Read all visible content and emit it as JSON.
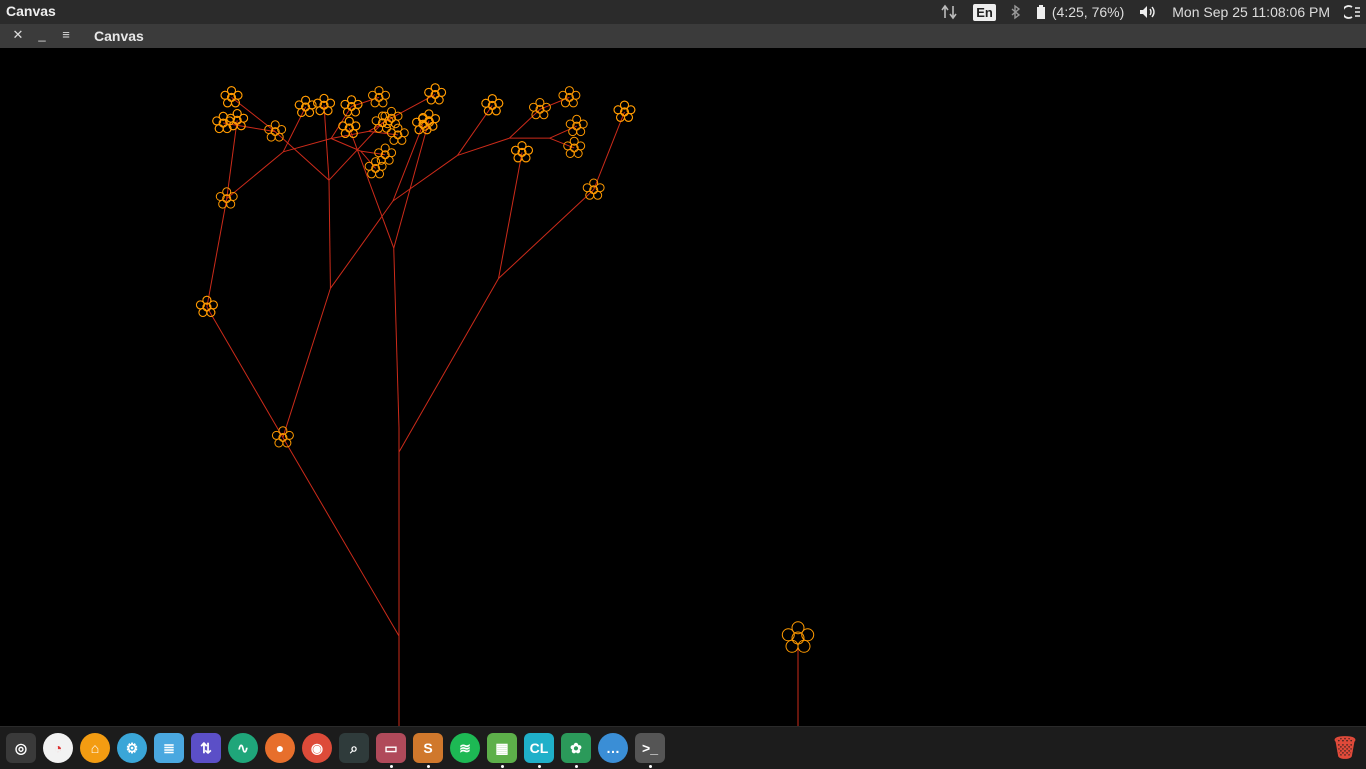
{
  "topbar": {
    "app_title": "Canvas",
    "keyboard_layout": "En",
    "battery_status": "(4:25, 76%)",
    "datetime": "Mon Sep 25 11:08:06 PM"
  },
  "window": {
    "title": "Canvas",
    "close_glyph": "✕",
    "minimize_glyph": "_",
    "menu_glyph": "≡"
  },
  "canvas": {
    "background": "#000000",
    "branch_color": "#cc2b1a",
    "flower_color": "#ff9a00"
  },
  "dock": {
    "items": [
      {
        "name": "launcher-icon",
        "color": "#3a3a3a",
        "glyph": "◎"
      },
      {
        "name": "disk-usage-icon",
        "color": "#f2f2f2",
        "glyph": "◔"
      },
      {
        "name": "ubuntu-software-icon",
        "color": "#f39c12",
        "glyph": "⌂"
      },
      {
        "name": "settings-icon",
        "color": "#3aa6d8",
        "glyph": "⚙"
      },
      {
        "name": "text-editor-icon",
        "color": "#4aa8e0",
        "glyph": "≣"
      },
      {
        "name": "network-icon",
        "color": "#5b4fc7",
        "glyph": "⇅"
      },
      {
        "name": "system-monitor-icon",
        "color": "#1fa67a",
        "glyph": "∿"
      },
      {
        "name": "firefox-icon",
        "color": "#e76f2c",
        "glyph": "●"
      },
      {
        "name": "chrome-icon",
        "color": "#dd4b39",
        "glyph": "◉"
      },
      {
        "name": "screenshot-icon",
        "color": "#2f3b3b",
        "glyph": "⌕"
      },
      {
        "name": "files-icon",
        "color": "#b04a5a",
        "glyph": "▭"
      },
      {
        "name": "sublime-text-icon",
        "color": "#d0782c",
        "glyph": "S"
      },
      {
        "name": "spotify-icon",
        "color": "#1db954",
        "glyph": "≋"
      },
      {
        "name": "image-viewer-icon",
        "color": "#5db04a",
        "glyph": "▦"
      },
      {
        "name": "clion-icon",
        "color": "#1fb0c9",
        "glyph": "CL"
      },
      {
        "name": "game-icon",
        "color": "#2b9a5a",
        "glyph": "✿"
      },
      {
        "name": "more-apps-icon",
        "color": "#3a8ed6",
        "glyph": "…"
      },
      {
        "name": "terminal-icon",
        "color": "#555555",
        "glyph": ">_"
      }
    ],
    "trash_glyph": "🗑"
  }
}
